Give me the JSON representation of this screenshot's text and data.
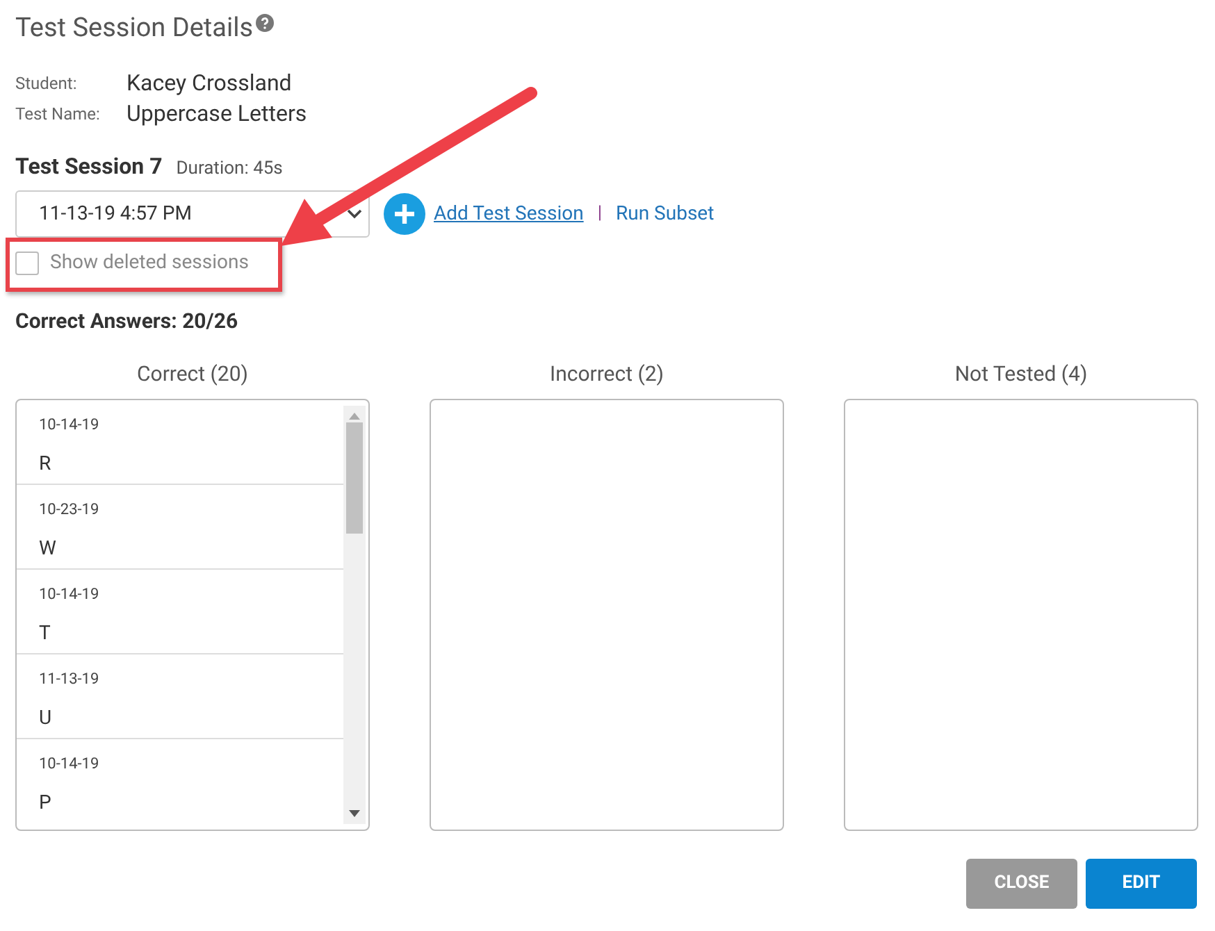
{
  "title": "Test Session Details",
  "info": [
    {
      "label": "Student:",
      "value": "Kacey Crossland"
    },
    {
      "label": "Test Name:",
      "value": "Uppercase Letters"
    }
  ],
  "session": {
    "title": "Test Session 7",
    "duration": "Duration: 45s",
    "selected_value": "11-13-19 4:57 PM"
  },
  "links": [
    "Add Test Session",
    "Run Subset"
  ],
  "link_separator": "|",
  "show_deleted": {
    "label": "Show deleted sessions",
    "checked": false
  },
  "summary": "Correct Answers: 20/26",
  "columns": [
    {
      "title": "Correct (20)",
      "items": [
        {
          "date": "10-14-19",
          "letter": "R"
        },
        {
          "date": "10-23-19",
          "letter": "W"
        },
        {
          "date": "10-14-19",
          "letter": "T"
        },
        {
          "date": "11-13-19",
          "letter": "U"
        },
        {
          "date": "10-14-19",
          "letter": "P"
        }
      ]
    },
    {
      "title": "Incorrect (2)"
    },
    {
      "title": "Not Tested (4)"
    }
  ],
  "buttons": [
    {
      "label": "CLOSE",
      "kind": "secondary"
    },
    {
      "label": "EDIT",
      "kind": "primary"
    }
  ]
}
